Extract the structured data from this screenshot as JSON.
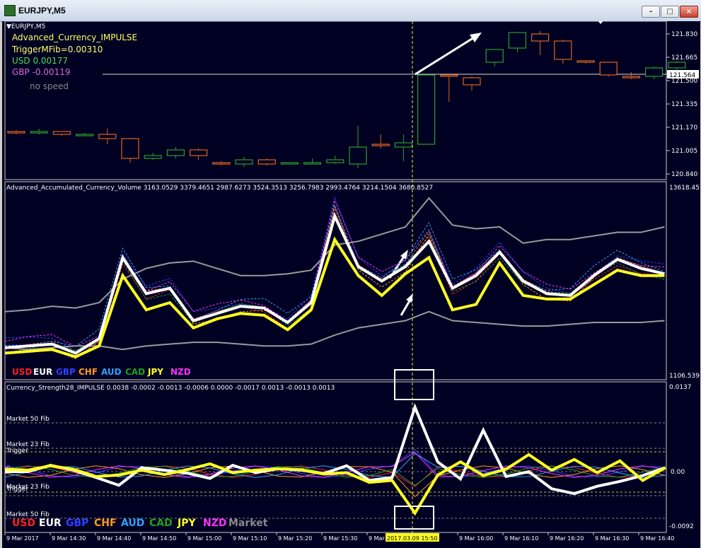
{
  "window": {
    "title": "EURJPY,M5",
    "btn_min": "–",
    "btn_max": "□",
    "btn_close": "×"
  },
  "panel1": {
    "symbol_label": "▼EURJPY,M5",
    "indicator_name": "Advanced_Currency_IMPULSE",
    "trigger": "TriggerMFib=0.00310",
    "usd": "USD 0.00177",
    "gbp": "GBP -0.00119",
    "speed": "no speed",
    "price_ticks": [
      "121.830",
      "121.665",
      "121.500",
      "121.335",
      "121.170",
      "121.005",
      "120.840"
    ],
    "current_price": "121.564",
    "colors": {
      "bull": "#2aa02a",
      "bear": "#e0641e",
      "text_yellow": "#ffff66",
      "text_green": "#55dd55",
      "text_magenta": "#dd66dd",
      "text_gray": "#888888"
    }
  },
  "candles": {
    "ohlc": [
      [
        121.14,
        121.15,
        121.12,
        121.13
      ],
      [
        121.13,
        121.16,
        121.12,
        121.14
      ],
      [
        121.14,
        121.14,
        121.11,
        121.12
      ],
      [
        121.12,
        121.13,
        121.11,
        121.12
      ],
      [
        121.12,
        121.16,
        121.05,
        121.09
      ],
      [
        121.09,
        121.09,
        120.92,
        120.95
      ],
      [
        120.95,
        120.99,
        120.94,
        120.97
      ],
      [
        120.97,
        121.03,
        120.95,
        121.01
      ],
      [
        121.01,
        121.02,
        120.94,
        120.97
      ],
      [
        120.92,
        120.93,
        120.9,
        120.91
      ],
      [
        120.91,
        120.96,
        120.89,
        120.94
      ],
      [
        120.94,
        120.95,
        120.9,
        120.91
      ],
      [
        120.91,
        120.92,
        120.91,
        120.92
      ],
      [
        120.92,
        120.95,
        120.91,
        120.92
      ],
      [
        120.92,
        120.97,
        120.91,
        120.94
      ],
      [
        120.91,
        121.18,
        120.88,
        121.03
      ],
      [
        121.05,
        121.12,
        121.02,
        121.04
      ],
      [
        121.03,
        121.12,
        120.93,
        121.06
      ],
      [
        121.05,
        121.55,
        121.05,
        121.54
      ],
      [
        121.54,
        121.55,
        121.35,
        121.53
      ],
      [
        121.52,
        121.53,
        121.43,
        121.47
      ],
      [
        121.63,
        121.72,
        121.6,
        121.72
      ],
      [
        121.73,
        121.84,
        121.7,
        121.84
      ],
      [
        121.83,
        121.85,
        121.68,
        121.78
      ],
      [
        121.78,
        121.79,
        121.62,
        121.65
      ],
      [
        121.64,
        121.64,
        121.62,
        121.63
      ],
      [
        121.63,
        121.63,
        121.53,
        121.54
      ],
      [
        121.53,
        121.56,
        121.51,
        121.52
      ],
      [
        121.53,
        121.6,
        121.51,
        121.59
      ],
      [
        121.59,
        121.64,
        121.57,
        121.63
      ]
    ],
    "ylim": [
      120.82,
      121.9
    ]
  },
  "panel2": {
    "header": "Advanced_Accumulated_Currency_Volume  3163.0529 3379.4651 2987.6273 3524.3513 3256.7983 2993.4764 3214.1504 3680.8527",
    "top_tick": "13618.45",
    "bottom_tick": "1106.539",
    "legend": [
      {
        "name": "USD",
        "color": "#ff2020"
      },
      {
        "name": "EUR",
        "color": "#ffffff"
      },
      {
        "name": "GBP",
        "color": "#3040ff"
      },
      {
        "name": "CHF",
        "color": "#ff9a20"
      },
      {
        "name": "AUD",
        "color": "#30a0ff"
      },
      {
        "name": "CAD",
        "color": "#20a020"
      },
      {
        "name": "JPY",
        "color": "#ffff20"
      },
      {
        "name": "NZD",
        "color": "#ff30ff"
      }
    ],
    "series": {
      "eur": [
        0.15,
        0.16,
        0.17,
        0.12,
        0.2,
        0.65,
        0.45,
        0.48,
        0.3,
        0.34,
        0.38,
        0.37,
        0.29,
        0.4,
        0.88,
        0.6,
        0.52,
        0.6,
        0.74,
        0.48,
        0.55,
        0.68,
        0.52,
        0.45,
        0.44,
        0.55,
        0.64,
        0.59,
        0.56
      ],
      "jpy": [
        0.12,
        0.13,
        0.14,
        0.1,
        0.16,
        0.55,
        0.36,
        0.4,
        0.26,
        0.31,
        0.34,
        0.33,
        0.25,
        0.36,
        0.75,
        0.55,
        0.44,
        0.56,
        0.65,
        0.36,
        0.39,
        0.62,
        0.44,
        0.42,
        0.42,
        0.5,
        0.58,
        0.55,
        0.55
      ],
      "gray_upper": [
        0.35,
        0.36,
        0.38,
        0.37,
        0.4,
        0.53,
        0.59,
        0.62,
        0.63,
        0.59,
        0.55,
        0.55,
        0.56,
        0.58,
        0.72,
        0.74,
        0.78,
        0.82,
        0.98,
        0.83,
        0.81,
        0.82,
        0.73,
        0.75,
        0.75,
        0.77,
        0.79,
        0.79,
        0.82
      ],
      "gray_lower": [
        0.15,
        0.14,
        0.15,
        0.16,
        0.16,
        0.14,
        0.16,
        0.17,
        0.18,
        0.18,
        0.17,
        0.16,
        0.16,
        0.17,
        0.22,
        0.26,
        0.28,
        0.3,
        0.35,
        0.3,
        0.29,
        0.28,
        0.27,
        0.27,
        0.28,
        0.29,
        0.29,
        0.29,
        0.3
      ]
    },
    "colors": {
      "gray": "#9a9a9a"
    }
  },
  "panel3": {
    "header": "Currency_Strength28_IMPULSE  0.0038 -0.0002 -0.0013 -0.0006 0.0000 -0.0017 0.0013 -0.0013 0.0013",
    "top_tick": "0.0137",
    "mid_tick": "0.00",
    "bottom_tick": "-0.0092",
    "levels": {
      "market50_top": "Market 50 Fib",
      "market23_top": "Market 23 Fib",
      "trigger_top": "Trigger",
      "zero": "0",
      "trigger_bottom": "Trigger",
      "market23_bottom": "Market 23 Fib",
      "market50_bottom": "Market 50 Fib"
    },
    "legend_extra": {
      "name": "Market",
      "color": "#8a8a8a"
    },
    "series": {
      "white": [
        0.0,
        0.0,
        0.0013,
        0.0003,
        -0.0012,
        -0.0028,
        0.0008,
        0.0003,
        -0.0003,
        -0.0014,
        0.0013,
        -0.0002,
        0.0006,
        0.0003,
        -0.0004,
        0.0012,
        -0.0018,
        -0.0012,
        0.0132,
        0.002,
        -0.0015,
        0.0085,
        -0.001,
        0.0,
        -0.0035,
        -0.0045,
        -0.003,
        -0.002,
        -0.0008,
        0.0008
      ],
      "yellow": [
        0.0005,
        0.0003,
        0.0012,
        0.0005,
        -0.001,
        -0.0007,
        0.0003,
        -0.0006,
        0.0004,
        0.0016,
        -0.0002,
        0.0003,
        0.0006,
        0.0004,
        -0.0005,
        -0.0002,
        -0.0022,
        -0.0018,
        -0.0085,
        -0.0007,
        0.002,
        -0.0008,
        0.0005,
        0.0035,
        0.0003,
        0.0025,
        -0.0002,
        0.0022,
        -0.0018,
        0.0008
      ]
    },
    "colors": {
      "white": "#ffffff",
      "yellow": "#ffff20"
    }
  },
  "time_axis": {
    "labels": [
      "9 Mar 2017",
      "9 Mar 14:30",
      "9 Mar 14:40",
      "9 Mar 14:50",
      "9 Mar 15:00",
      "9 Mar 15:10",
      "9 Mar 15:20",
      "9 Mar 15:30",
      "9 Mar 15:40",
      "2017.03.09 15:50",
      "9 Mar 16:00",
      "9 Mar 16:10",
      "9 Mar 16:20",
      "9 Mar 16:30",
      "9 Mar 16:40"
    ],
    "highlight_index": 9
  }
}
